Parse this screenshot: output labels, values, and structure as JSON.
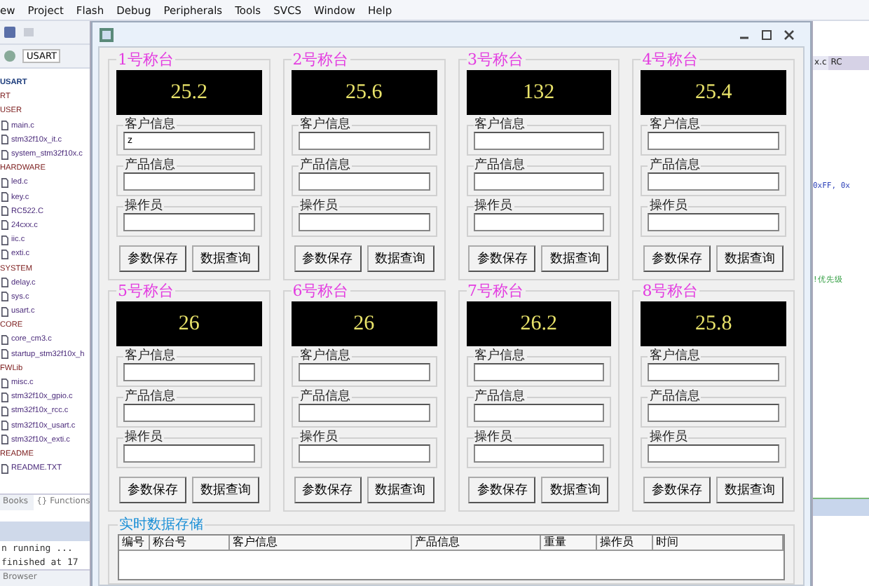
{
  "menu": [
    "ew",
    "Project",
    "Flash",
    "Debug",
    "Peripherals",
    "Tools",
    "SVCS",
    "Window",
    "Help"
  ],
  "toolbar": {
    "target": "USART"
  },
  "project_tree": [
    {
      "label": "USART",
      "kind": "target"
    },
    {
      "label": "RT",
      "kind": "group"
    },
    {
      "label": "USER",
      "kind": "group",
      "children": [
        {
          "label": "main.c"
        },
        {
          "label": "stm32f10x_it.c"
        },
        {
          "label": "system_stm32f10x.c"
        }
      ]
    },
    {
      "label": "HARDWARE",
      "kind": "group",
      "children": [
        {
          "label": "led.c"
        },
        {
          "label": "key.c"
        },
        {
          "label": "RC522.C"
        },
        {
          "label": "24cxx.c"
        },
        {
          "label": "iic.c"
        },
        {
          "label": "exti.c"
        }
      ]
    },
    {
      "label": "SYSTEM",
      "kind": "group",
      "children": [
        {
          "label": "delay.c"
        },
        {
          "label": "sys.c"
        },
        {
          "label": "usart.c"
        }
      ]
    },
    {
      "label": "CORE",
      "kind": "group",
      "children": [
        {
          "label": "core_cm3.c"
        },
        {
          "label": "startup_stm32f10x_h"
        }
      ]
    },
    {
      "label": "FWLib",
      "kind": "group",
      "children": [
        {
          "label": "misc.c"
        },
        {
          "label": "stm32f10x_gpio.c"
        },
        {
          "label": "stm32f10x_rcc.c"
        },
        {
          "label": "stm32f10x_usart.c"
        },
        {
          "label": "stm32f10x_exti.c"
        }
      ]
    },
    {
      "label": "README",
      "kind": "group",
      "children": [
        {
          "label": "README.TXT"
        }
      ]
    }
  ],
  "panel_tabs": [
    {
      "label": "Books",
      "selected": false
    },
    {
      "label": "{} Functions",
      "selected": true
    }
  ],
  "output_lines": [
    "n running ...",
    "finished at 17"
  ],
  "output_tabs": [
    {
      "label": "Browser",
      "selected": false
    }
  ],
  "editor_tabs": [
    {
      "label": "x.c",
      "selected": true
    },
    {
      "label": "RC",
      "selected": false
    }
  ],
  "code_lines": [
    {
      "text": "0xFF, 0x",
      "kind": "code"
    },
    {
      "text": "!优先级",
      "kind": "comment"
    }
  ],
  "scales": [
    {
      "title": "1号称台",
      "reading": "25.2",
      "fields": [
        {
          "label": "客户信息",
          "value": "z"
        },
        {
          "label": "产品信息"
        },
        {
          "label": "操作员"
        }
      ],
      "buttons": [
        "参数保存",
        "数据查询"
      ]
    },
    {
      "title": "2号称台",
      "reading": "25.6",
      "fields": [
        {
          "label": "客户信息"
        },
        {
          "label": "产品信息"
        },
        {
          "label": "操作员"
        }
      ],
      "buttons": [
        "参数保存",
        "数据查询"
      ]
    },
    {
      "title": "3号称台",
      "reading": "132",
      "fields": [
        {
          "label": "客户信息"
        },
        {
          "label": "产品信息"
        },
        {
          "label": "操作员"
        }
      ],
      "buttons": [
        "参数保存",
        "数据查询"
      ]
    },
    {
      "title": "4号称台",
      "reading": "25.4",
      "fields": [
        {
          "label": "客户信息"
        },
        {
          "label": "产品信息"
        },
        {
          "label": "操作员"
        }
      ],
      "buttons": [
        "参数保存",
        "数据查询"
      ]
    },
    {
      "title": "5号称台",
      "reading": "26",
      "fields": [
        {
          "label": "客户信息"
        },
        {
          "label": "产品信息"
        },
        {
          "label": "操作员"
        }
      ],
      "buttons": [
        "参数保存",
        "数据查询"
      ]
    },
    {
      "title": "6号称台",
      "reading": "26",
      "fields": [
        {
          "label": "客户信息"
        },
        {
          "label": "产品信息"
        },
        {
          "label": "操作员"
        }
      ],
      "buttons": [
        "参数保存",
        "数据查询"
      ]
    },
    {
      "title": "7号称台",
      "reading": "26.2",
      "fields": [
        {
          "label": "客户信息"
        },
        {
          "label": "产品信息"
        },
        {
          "label": "操作员"
        }
      ],
      "buttons": [
        "参数保存",
        "数据查询"
      ]
    },
    {
      "title": "8号称台",
      "reading": "25.8",
      "fields": [
        {
          "label": "客户信息"
        },
        {
          "label": "产品信息"
        },
        {
          "label": "操作员"
        }
      ],
      "buttons": [
        "参数保存",
        "数据查询"
      ]
    }
  ],
  "storage": {
    "title": "实时数据存储",
    "columns": [
      "编号",
      "称台号",
      "客户信息",
      "产品信息",
      "重量",
      "操作员",
      "时间"
    ]
  }
}
